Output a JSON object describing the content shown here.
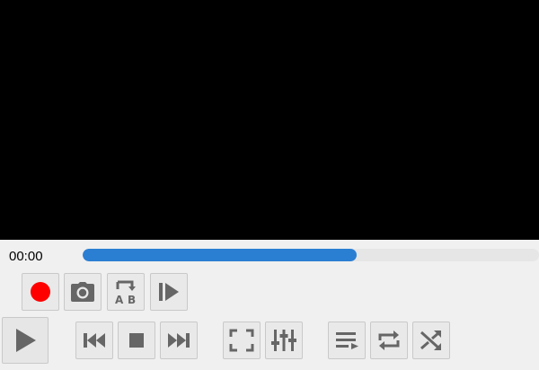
{
  "player": {
    "time_elapsed": "00:00",
    "progress": 0.6
  },
  "colors": {
    "video_bg": "#000000",
    "panel_bg": "#f0f0f0",
    "accent": "#2b7fd3",
    "record_red": "#ff0000",
    "icon_gray": "#666666"
  },
  "toolbar_advanced": [
    {
      "icon": "record-icon"
    },
    {
      "icon": "camera-icon"
    },
    {
      "icon": "ab-loop-icon",
      "label_a": "A",
      "label_b": "B"
    },
    {
      "icon": "frame-step-icon"
    }
  ],
  "toolbar_main": [
    {
      "icon": "play-icon"
    },
    {
      "icon": "previous-icon"
    },
    {
      "icon": "stop-icon"
    },
    {
      "icon": "next-icon"
    },
    {
      "icon": "fullscreen-icon"
    },
    {
      "icon": "equalizer-icon"
    },
    {
      "icon": "playlist-icon"
    },
    {
      "icon": "repeat-icon"
    },
    {
      "icon": "shuffle-icon"
    }
  ]
}
